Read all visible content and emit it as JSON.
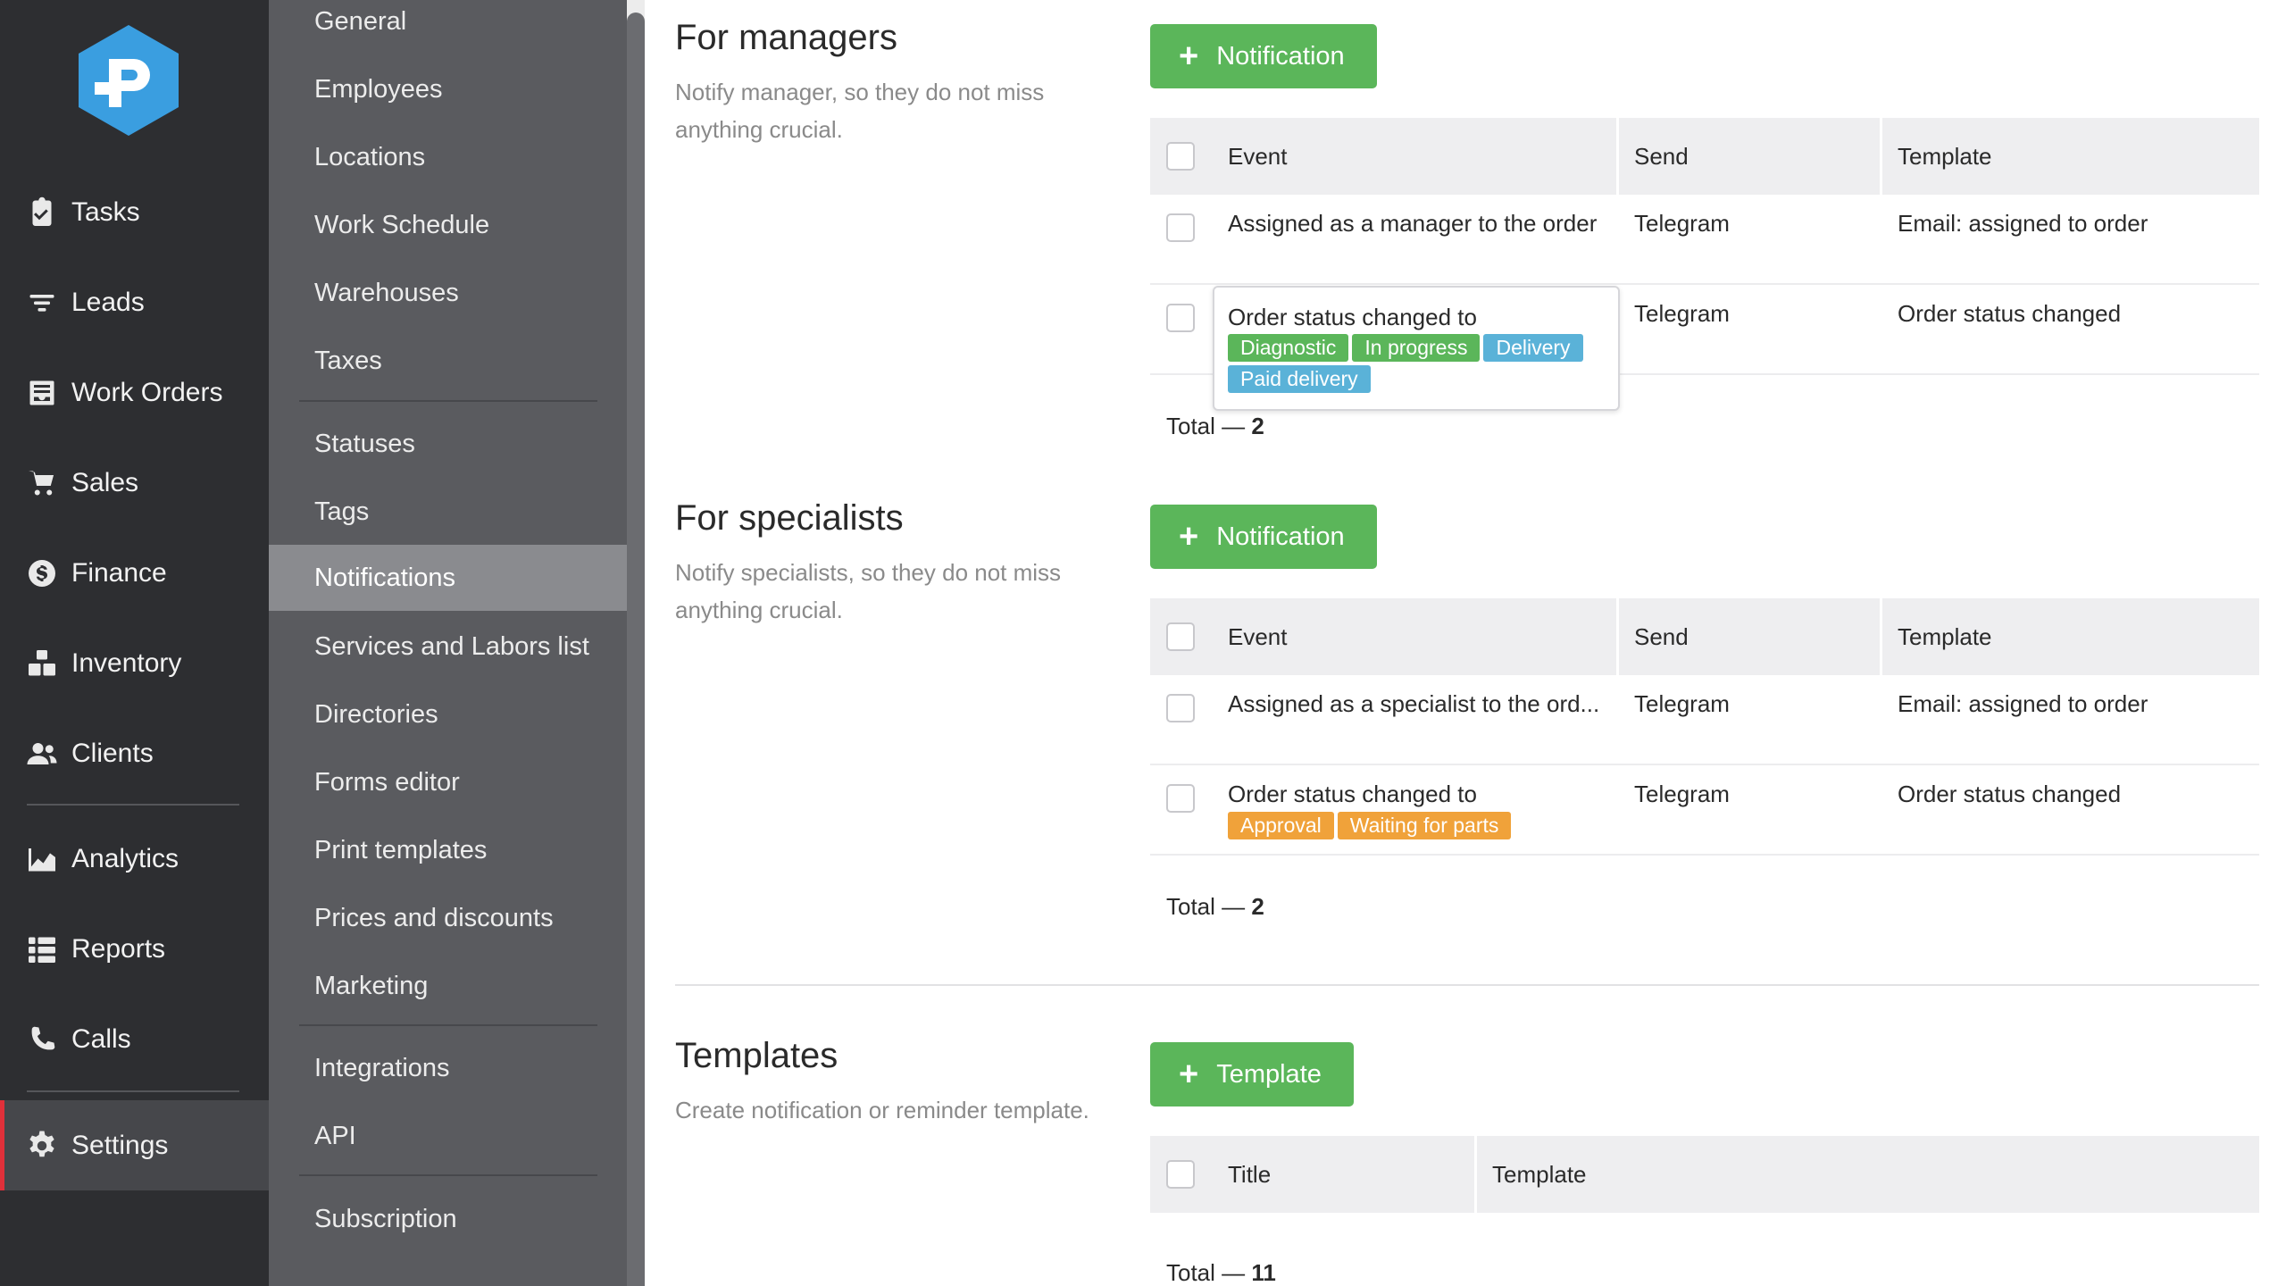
{
  "colors": {
    "primary_nav_bg": "#2d2e31",
    "secondary_nav_bg": "#5a5b5f",
    "active_secondary": "#8a8b8f",
    "active_indicator": "#e0303a",
    "button_green": "#5bb65a",
    "tag_green": "#5bb65a",
    "tag_blue": "#5ab2d8",
    "tag_orange": "#f0a23a",
    "logo_blue": "#3a9ee0"
  },
  "primary_nav": {
    "items": [
      {
        "label": "Tasks",
        "icon": "clipboard-check-icon"
      },
      {
        "label": "Leads",
        "icon": "filter-icon"
      },
      {
        "label": "Work Orders",
        "icon": "inbox-icon"
      },
      {
        "label": "Sales",
        "icon": "cart-icon"
      },
      {
        "label": "Finance",
        "icon": "dollar-icon"
      },
      {
        "label": "Inventory",
        "icon": "boxes-icon"
      },
      {
        "label": "Clients",
        "icon": "users-icon"
      },
      {
        "label": "Analytics",
        "icon": "chart-area-icon"
      },
      {
        "label": "Reports",
        "icon": "list-icon"
      },
      {
        "label": "Calls",
        "icon": "phone-icon"
      },
      {
        "label": "Settings",
        "icon": "gear-icon",
        "active": true
      }
    ]
  },
  "settings_nav": {
    "items": [
      "General",
      "Employees",
      "Locations",
      "Work Schedule",
      "Warehouses",
      "Taxes",
      "Statuses",
      "Tags",
      "Notifications",
      "Services and Labors list",
      "Directories",
      "Forms editor",
      "Print templates",
      "Prices and discounts",
      "Marketing",
      "Integrations",
      "API",
      "Subscription"
    ],
    "active": "Notifications"
  },
  "managers": {
    "title": "For managers",
    "description": "Notify manager, so they do not miss anything crucial.",
    "button_label": "Notification",
    "headers": {
      "event": "Event",
      "send": "Send",
      "template": "Template"
    },
    "rows": [
      {
        "event": "Assigned as a manager to the order",
        "send": "Telegram",
        "template": "Email: assigned to order"
      },
      {
        "event": "Order status changed to",
        "send": "Telegram",
        "template": "Order status changed",
        "tags": [
          {
            "label": "Diagnostic",
            "color": "#5bb65a"
          },
          {
            "label": "In progress",
            "color": "#5bb65a"
          },
          {
            "label": "Delivery",
            "color": "#5ab2d8"
          },
          {
            "label": "Paid delivery",
            "color": "#5ab2d8"
          }
        ]
      }
    ],
    "total_label": "Total —",
    "total_value": "2"
  },
  "specialists": {
    "title": "For specialists",
    "description": "Notify specialists, so they do not miss anything crucial.",
    "button_label": "Notification",
    "headers": {
      "event": "Event",
      "send": "Send",
      "template": "Template"
    },
    "rows": [
      {
        "event": "Assigned as a specialist to the ord...",
        "send": "Telegram",
        "template": "Email: assigned to order"
      },
      {
        "event": "Order status changed to",
        "send": "Telegram",
        "template": "Order status changed",
        "tags": [
          {
            "label": "Approval",
            "color": "#f0a23a"
          },
          {
            "label": "Waiting for parts",
            "color": "#f0a23a"
          }
        ]
      }
    ],
    "total_label": "Total —",
    "total_value": "2"
  },
  "templates": {
    "title": "Templates",
    "description": "Create notification or reminder template.",
    "button_label": "Template",
    "headers": {
      "title": "Title",
      "template": "Template"
    },
    "total_label": "Total —",
    "total_value": "11"
  }
}
